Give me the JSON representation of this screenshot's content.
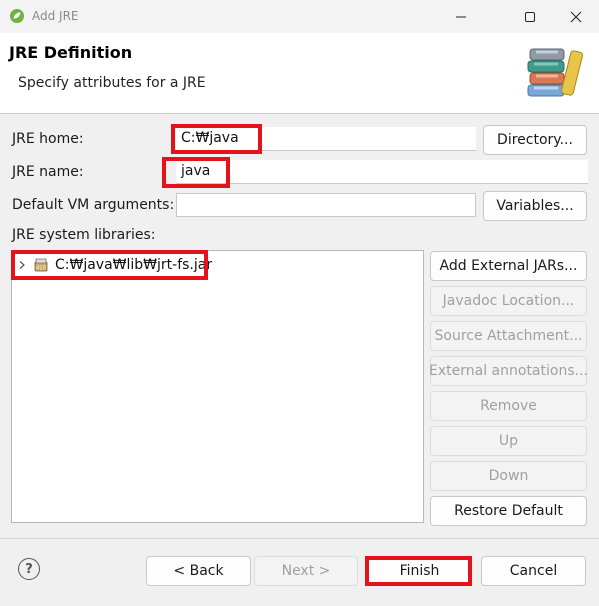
{
  "window": {
    "title": "Add JRE"
  },
  "header": {
    "title": "JRE Definition",
    "description": "Specify attributes for a JRE"
  },
  "form": {
    "jre_home": {
      "label": "JRE home:",
      "value": "C:₩java"
    },
    "jre_name": {
      "label": "JRE name:",
      "value": "java"
    },
    "vm_args": {
      "label": "Default VM arguments:",
      "value": ""
    },
    "directory_button": "Directory...",
    "variables_button": "Variables..."
  },
  "libraries": {
    "label": "JRE system libraries:",
    "items": [
      {
        "path": "C:₩java₩lib₩jrt-fs.jar"
      }
    ]
  },
  "side_buttons": {
    "add_external_jars": "Add External JARs...",
    "javadoc_location": "Javadoc Location...",
    "source_attachment": "Source Attachment...",
    "external_annotations": "External annotations...",
    "remove": "Remove",
    "up": "Up",
    "down": "Down",
    "restore_default": "Restore Default"
  },
  "footer": {
    "help": "?",
    "back": "< Back",
    "next": "Next >",
    "finish": "Finish",
    "cancel": "Cancel"
  },
  "colors": {
    "highlight": "#e4121c",
    "dialog_bg": "#f0f0f0",
    "header_bg": "#ffffff"
  }
}
